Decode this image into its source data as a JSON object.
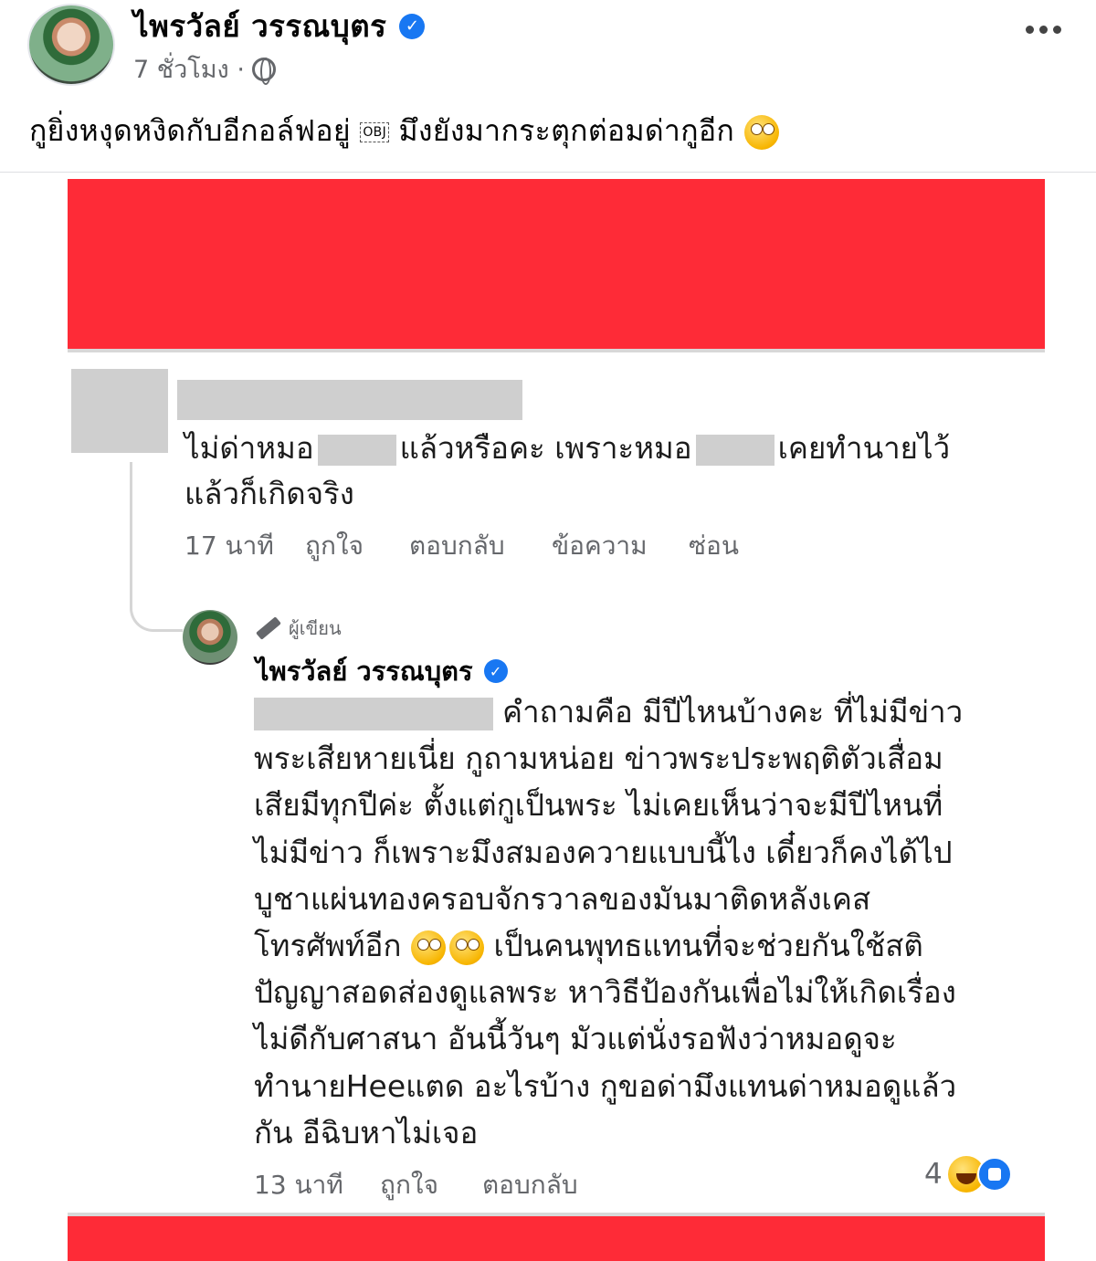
{
  "post": {
    "author": "ไพรวัลย์ วรรณบุตร",
    "verified_mark": "✓",
    "time": "7 ชั่วโมง ·",
    "text_before": "กูยิ่งหงุดหงิดกับอีกอล์ฟอยู่ ",
    "obj_marker": "OBJ",
    "text_after": " มึงยังมากระตุกต่อมด่ากูอีก "
  },
  "comment1": {
    "text_part1": "ไม่ด่าหมอ",
    "text_part2": "แล้วหรือคะ เพราะหมอ",
    "text_part3": "เคยทำนายไว้",
    "text_line2": "แล้วก็เกิดจริง",
    "time": "17 นาที",
    "like": "ถูกใจ",
    "reply": "ตอบกลับ",
    "message": "ข้อความ",
    "hide": "ซ่อน"
  },
  "reply": {
    "author_tag": "ผู้เขียน",
    "author": "ไพรวัลย์ วรรณบุตร",
    "verified_mark": "✓",
    "line1": "คำถามคือ มีปีไหนบ้างคะ ที่ไม่มีข่าว",
    "line2": "พระเสียหายเนี่ย กูถามหน่อย ข่าวพระประพฤติตัวเสื่อม",
    "line3": "เสียมีทุกปีค่ะ ตั้งแต่กูเป็นพระ ไม่เคยเห็นว่าจะมีปีไหนที่",
    "line4": "ไม่มีข่าว ก็เพราะมึงสมองควายแบบนี้ไง  เดี๋ยวก็คงได้ไป",
    "line5": "บูชาแผ่นทองครอบจักรวาลของมันมาติดหลังเคส",
    "line6a": "โทรศัพท์อีก ",
    "line6b": " เป็นคนพุทธแทนที่จะช่วยกันใช้สติ",
    "line7": "ปัญญาสอดส่องดูแลพระ หาวิธีป้องกันเพื่อไม่ให้เกิดเรื่อง",
    "line8": "ไม่ดีกับศาสนา อันนี้วันๆ มัวแต่นั่งรอฟังว่าหมอดูจะ",
    "line9": "ทำนายHeeแตด อะไรบ้าง กูขอด่ามึงแทนด่าหมอดูแล้ว",
    "line10": "กัน อีฉิบหาไม่เจอ",
    "time": "13 นาที",
    "like": "ถูกใจ",
    "reply": "ตอบกลับ",
    "reaction_count": "4"
  }
}
